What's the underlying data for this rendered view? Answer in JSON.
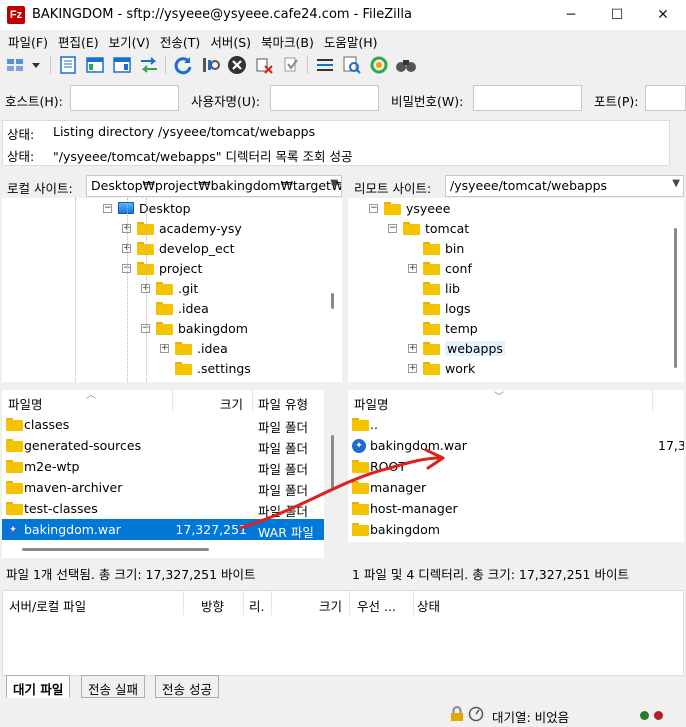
{
  "window": {
    "title": "BAKINGDOM - sftp://ysyeee@ysyeee.cafe24.com - FileZilla",
    "app_icon_text": "Fz"
  },
  "menu": [
    "파일(F)",
    "편집(E)",
    "보기(V)",
    "전송(T)",
    "서버(S)",
    "북마크(B)",
    "도움말(H)"
  ],
  "quickconnect": {
    "host_label": "호스트(H):",
    "user_label": "사용자명(U):",
    "pass_label": "비밀번호(W):",
    "port_label": "포트(P):",
    "host_value": "",
    "user_value": "",
    "pass_value": "",
    "port_value": ""
  },
  "log": [
    {
      "label": "상태:",
      "text": "Listing directory /ysyeee/tomcat/webapps"
    },
    {
      "label": "상태:",
      "text": "\"/ysyeee/tomcat/webapps\" 디렉터리 목록 조회 성공"
    }
  ],
  "local": {
    "site_label": "로컬 사이트:",
    "path": "Desktop₩project₩bakingdom₩target₩",
    "tree": [
      {
        "name": "Desktop",
        "expander": "−",
        "kind": "desktop"
      },
      {
        "name": "academy-ysy",
        "expander": "+",
        "kind": "folder"
      },
      {
        "name": "develop_ect",
        "expander": "+",
        "kind": "folder"
      },
      {
        "name": "project",
        "expander": "−",
        "kind": "folder"
      },
      {
        "name": ".git",
        "expander": "+",
        "kind": "folder"
      },
      {
        "name": ".idea",
        "expander": "",
        "kind": "folder"
      },
      {
        "name": "bakingdom",
        "expander": "−",
        "kind": "folder"
      },
      {
        "name": ".idea",
        "expander": "+",
        "kind": "folder"
      },
      {
        "name": ".settings",
        "expander": "",
        "kind": "folder"
      }
    ],
    "columns": {
      "name": "파일명",
      "size": "크기",
      "type": "파일 유형"
    },
    "files": [
      {
        "name": "classes",
        "size": "",
        "type": "파일 폴더",
        "kind": "folder"
      },
      {
        "name": "generated-sources",
        "size": "",
        "type": "파일 폴더",
        "kind": "folder"
      },
      {
        "name": "m2e-wtp",
        "size": "",
        "type": "파일 폴더",
        "kind": "folder"
      },
      {
        "name": "maven-archiver",
        "size": "",
        "type": "파일 폴더",
        "kind": "folder"
      },
      {
        "name": "test-classes",
        "size": "",
        "type": "파일 폴더",
        "kind": "folder"
      },
      {
        "name": "bakingdom.war",
        "size": "17,327,251",
        "type": "WAR 파일",
        "kind": "war",
        "selected": true
      }
    ],
    "status": "파일 1개 선택됨. 총 크기: 17,327,251 바이트"
  },
  "remote": {
    "site_label": "리모트 사이트:",
    "path": "/ysyeee/tomcat/webapps",
    "tree": [
      {
        "name": "ysyeee",
        "expander": "−",
        "kind": "folder"
      },
      {
        "name": "tomcat",
        "expander": "−",
        "kind": "folder"
      },
      {
        "name": "bin",
        "expander": "",
        "kind": "folder"
      },
      {
        "name": "conf",
        "expander": "+",
        "kind": "folder"
      },
      {
        "name": "lib",
        "expander": "",
        "kind": "folder"
      },
      {
        "name": "logs",
        "expander": "",
        "kind": "folder"
      },
      {
        "name": "temp",
        "expander": "",
        "kind": "folder"
      },
      {
        "name": "webapps",
        "expander": "+",
        "kind": "folder",
        "highlight": true
      },
      {
        "name": "work",
        "expander": "+",
        "kind": "folder"
      }
    ],
    "columns": {
      "name": "파일명"
    },
    "files": [
      {
        "name": "..",
        "size": "",
        "kind": "folder"
      },
      {
        "name": "bakingdom.war",
        "size": "17,3",
        "kind": "war"
      },
      {
        "name": "ROOT",
        "size": "",
        "kind": "folder"
      },
      {
        "name": "manager",
        "size": "",
        "kind": "folder"
      },
      {
        "name": "host-manager",
        "size": "",
        "kind": "folder"
      },
      {
        "name": "bakingdom",
        "size": "",
        "kind": "folder"
      }
    ],
    "status": "1 파일 및 4 디렉터리. 총 크기: 17,327,251 바이트"
  },
  "queue": {
    "columns": [
      "서버/로컬 파일",
      "방향",
      "리.",
      "크기",
      "우선 ...",
      "상태"
    ],
    "tabs": [
      "대기 파일",
      "전송 실패",
      "전송 성공"
    ]
  },
  "statusbar": {
    "queue_text": "대기열: 비었음"
  },
  "colors": {
    "selection": "#0078d7",
    "arrow": "#e0201c"
  }
}
